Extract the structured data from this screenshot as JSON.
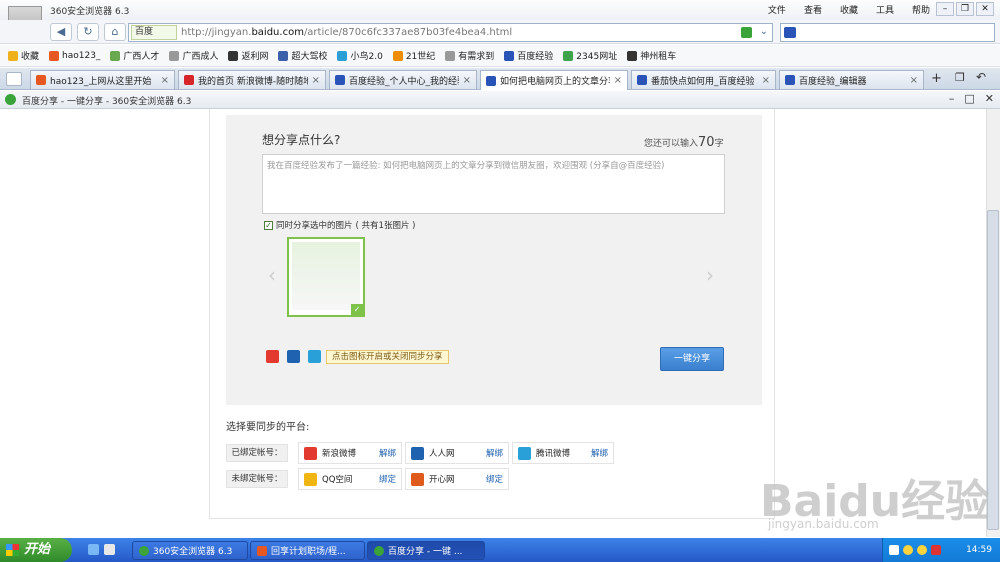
{
  "window": {
    "title": "360安全浏览器 6.3"
  },
  "menu": [
    "文件",
    "查看",
    "收藏",
    "工具",
    "帮助"
  ],
  "address": {
    "engine": "百度",
    "url_prefix": "http://jingyan.",
    "url_domain": "baidu.com",
    "url_rest": "/article/870c6fc337ae87b03fe4bea4.html"
  },
  "bookmarks": [
    {
      "label": "收藏",
      "icon": "star-icon",
      "color": "#f0b21c"
    },
    {
      "label": "hao123_",
      "icon": "hao123-icon",
      "color": "#e65722"
    },
    {
      "label": "广西人才",
      "icon": "page-icon",
      "color": "#6aa84f"
    },
    {
      "label": "广西成人",
      "icon": "page-icon",
      "color": "#999999"
    },
    {
      "label": "返利网",
      "icon": "page-icon",
      "color": "#333333"
    },
    {
      "label": "超大驾校",
      "icon": "page-icon",
      "color": "#3d5ea8"
    },
    {
      "label": "小鸟2.0",
      "icon": "page-icon",
      "color": "#2a9fd6"
    },
    {
      "label": "21世纪",
      "icon": "page-icon",
      "color": "#f08c00"
    },
    {
      "label": "有需求到",
      "icon": "page-icon",
      "color": "#999999"
    },
    {
      "label": "百度经验",
      "icon": "baidu-paw-icon",
      "color": "#2953b7"
    },
    {
      "label": "2345网址",
      "icon": "page-icon",
      "color": "#3fa14a"
    },
    {
      "label": "神州租车",
      "icon": "page-icon",
      "color": "#333333"
    }
  ],
  "tabs": [
    {
      "label": "hao123_上网从这里开始",
      "color": "#e65722",
      "active": false
    },
    {
      "label": "我的首页 新浪微博-随时随地",
      "color": "#d7262a",
      "active": false
    },
    {
      "label": "百度经验_个人中心_我的经验",
      "color": "#2953b7",
      "active": false
    },
    {
      "label": "如何把电脑网页上的文章分享",
      "color": "#2953b7",
      "active": true
    },
    {
      "label": "番茄快点如何用_百度经验",
      "color": "#2953b7",
      "active": false
    },
    {
      "label": "百度经验_编辑器",
      "color": "#2953b7",
      "active": false
    }
  ],
  "popup": {
    "title": "百度分享 - 一键分享 - 360安全浏览器 6.3"
  },
  "share": {
    "title": "想分享点什么?",
    "count_prefix": "您还可以输入",
    "count_value": "70",
    "count_suffix": "字",
    "message": "我在百度经验发布了一篇经验: 如何把电脑网页上的文章分享到微信朋友圈，欢迎围观 (分享自@百度经验)",
    "include_images": "同时分享选中的图片",
    "image_count": "( 共有1张图片 )",
    "hint": "点击图标开启或关闭同步分享",
    "button": "一键分享",
    "sync_icons": [
      {
        "icon": "weibo-icon",
        "color": "#e23a2e"
      },
      {
        "icon": "renren-icon",
        "color": "#1e62b0"
      },
      {
        "icon": "tencent-weibo-icon",
        "color": "#2aa0d8"
      }
    ]
  },
  "sync": {
    "title": "选择要同步的平台:",
    "bound_label": "已绑定帐号：",
    "unbound_label": "未绑定帐号：",
    "bound": [
      {
        "name": "新浪微博",
        "action": "解绑",
        "icon": "weibo-icon",
        "color": "#e23a2e"
      },
      {
        "name": "人人网",
        "action": "解绑",
        "icon": "renren-icon",
        "color": "#1e62b0"
      },
      {
        "name": "腾讯微博",
        "action": "解绑",
        "icon": "tencent-weibo-icon",
        "color": "#2aa0d8"
      }
    ],
    "unbound": [
      {
        "name": "QQ空间",
        "action": "绑定",
        "icon": "qzone-icon",
        "color": "#f1b512"
      },
      {
        "name": "开心网",
        "action": "绑定",
        "icon": "kaixin-icon",
        "color": "#e05a1c"
      }
    ]
  },
  "watermark": {
    "logo": "Baidu经验",
    "url": "jingyan.baidu.com"
  },
  "taskbar": {
    "start": "开始",
    "tasks": [
      {
        "label": "360安全浏览器 6.3",
        "active": false
      },
      {
        "label": "回享计划职场/程...",
        "active": false
      },
      {
        "label": "百度分享 - 一键 ...",
        "active": true
      }
    ],
    "clock": "14:59"
  }
}
